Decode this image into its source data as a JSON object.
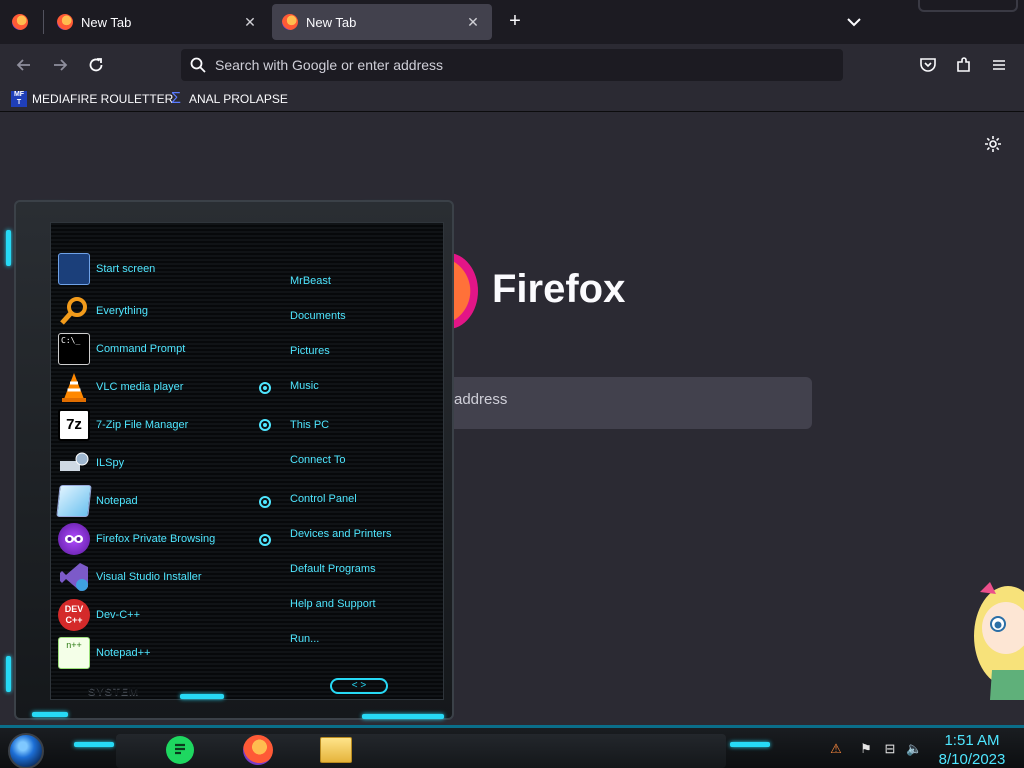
{
  "browser": {
    "tabs": [
      {
        "label": "New Tab",
        "active": false
      },
      {
        "label": "New Tab",
        "active": true
      }
    ],
    "new_tab_symbol": "+",
    "tab_list_symbol": "⌄",
    "close_symbol": "✕",
    "address_placeholder": "Search with Google or enter address",
    "bookmarks": [
      {
        "label": "MEDIAFIRE ROULETTER",
        "icon": "mediafire-icon"
      },
      {
        "label": "ANAL PROLAPSE",
        "icon": "sigma-icon"
      }
    ]
  },
  "newtab": {
    "brand": "Firefox",
    "search_placeholder": "address"
  },
  "start_menu": {
    "left_items": [
      {
        "label": "Start screen",
        "icon": "start-screen-icon",
        "color": "#2e6fd1"
      },
      {
        "label": "Everything",
        "icon": "magnifier-icon",
        "color": "#f29b1b"
      },
      {
        "label": "Command Prompt",
        "icon": "console-icon",
        "color": "#000000"
      },
      {
        "label": "VLC media player",
        "icon": "vlc-cone-icon",
        "color": "#ff8800"
      },
      {
        "label": "7-Zip File Manager",
        "icon": "7zip-icon",
        "color": "#ffffff"
      },
      {
        "label": "ILSpy",
        "icon": "ilspy-icon",
        "color": "#9fb7cf"
      },
      {
        "label": "Notepad",
        "icon": "notepad-icon",
        "color": "#8fd0ff"
      },
      {
        "label": "Firefox Private Browsing",
        "icon": "private-browsing-icon",
        "color": "#7b2fd6"
      },
      {
        "label": "Visual Studio Installer",
        "icon": "visual-studio-icon",
        "color": "#7c5ac9"
      },
      {
        "label": "Dev-C++",
        "icon": "devcpp-icon",
        "color": "#d42a2a"
      },
      {
        "label": "Notepad++",
        "icon": "notepadpp-icon",
        "color": "#9be07a"
      }
    ],
    "right_items": [
      "MrBeast",
      "Documents",
      "Pictures",
      "Music",
      "This PC",
      "Connect To",
      "Control Panel",
      "Devices and Printers",
      "Default Programs",
      "Help and Support",
      "Run..."
    ],
    "system_label": "SYSTEM",
    "arrows": "< >"
  },
  "taskbar": {
    "time": "1:51 AM",
    "date": "8/10/2023",
    "apps": [
      "notes-app-icon",
      "firefox-icon",
      "file-explorer-icon"
    ]
  },
  "colors": {
    "accent": "#4fe6ff",
    "browser_bg": "#2b2a33",
    "tabstrip_bg": "#1c1b22"
  }
}
